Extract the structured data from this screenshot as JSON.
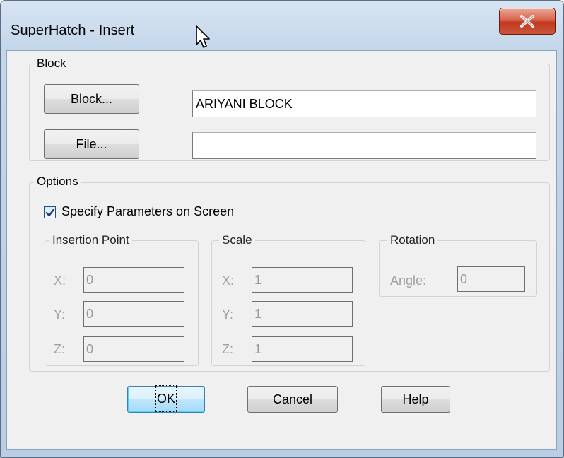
{
  "window": {
    "title": "SuperHatch - Insert",
    "close_glyph": "X"
  },
  "block_group": {
    "label": "Block",
    "block_button": "Block...",
    "block_value": "ARIYANI BLOCK",
    "file_button": "File...",
    "file_value": ""
  },
  "options_group": {
    "label": "Options",
    "specify_label": "Specify Parameters on Screen",
    "specify_checked": true,
    "insertion_point": {
      "label": "Insertion Point",
      "x_label": "X:",
      "x_value": "0",
      "y_label": "Y:",
      "y_value": "0",
      "z_label": "Z:",
      "z_value": "0"
    },
    "scale": {
      "label": "Scale",
      "x_label": "X:",
      "x_value": "1",
      "y_label": "Y:",
      "y_value": "1",
      "z_label": "Z:",
      "z_value": "1"
    },
    "rotation": {
      "label": "Rotation",
      "angle_label": "Angle:",
      "angle_value": "0"
    }
  },
  "buttons": {
    "ok": "OK",
    "cancel": "Cancel",
    "help": "Help"
  },
  "icons": [
    "close-icon",
    "checkmark-icon",
    "mouse-cursor-icon"
  ],
  "colors": {
    "close_button": "#c9563c",
    "default_button_border": "#3c7fb1",
    "disabled_text": "#a0a0a0"
  }
}
